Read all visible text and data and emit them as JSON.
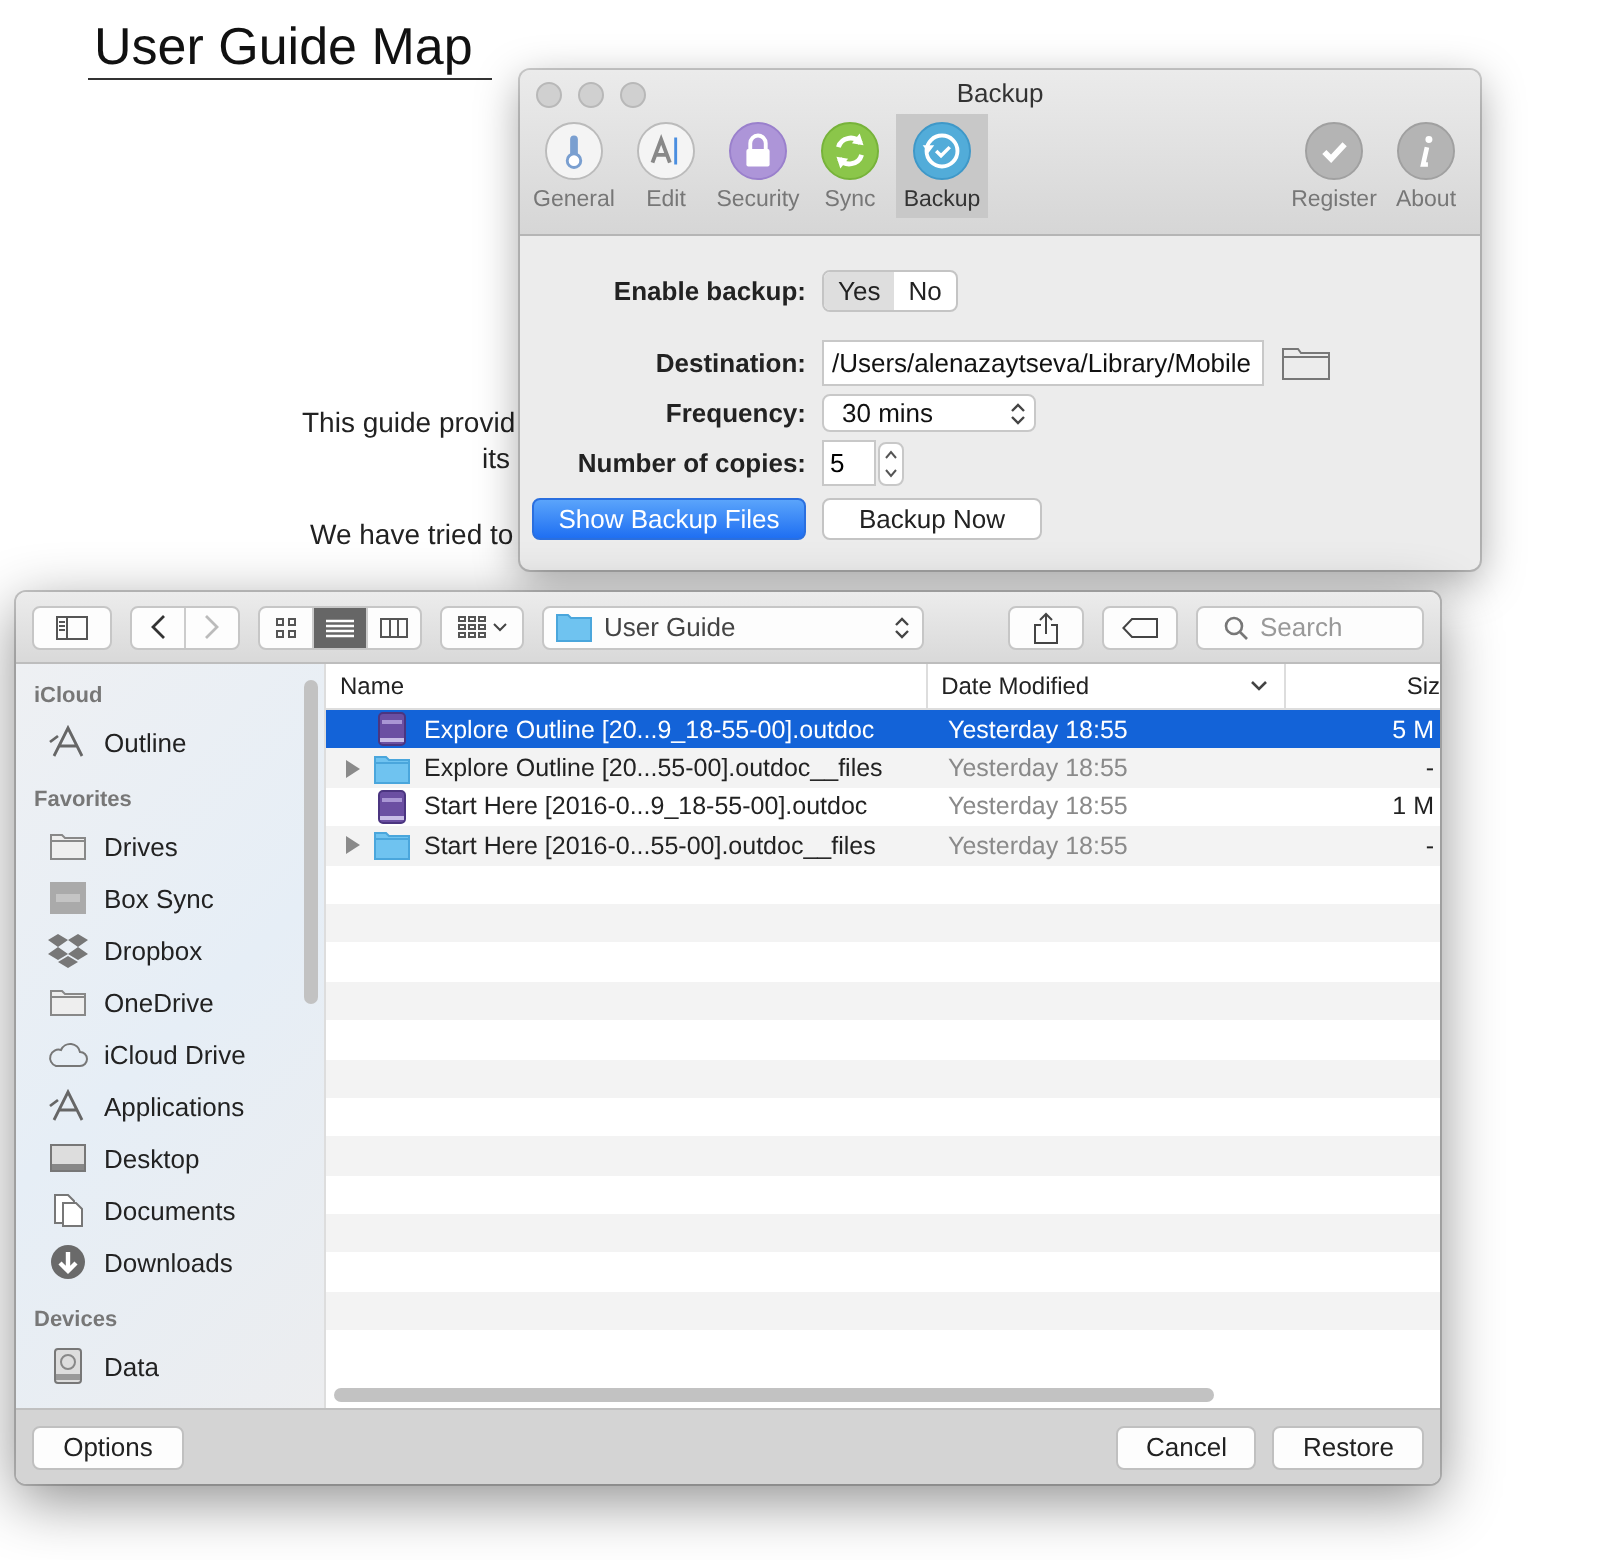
{
  "document": {
    "title": "User Guide Map",
    "paragraphs": [
      "This guide provid",
      "its",
      "We have tried to"
    ]
  },
  "preferences_window": {
    "title": "Backup",
    "tabs": [
      {
        "label": "General",
        "kind": "general",
        "selected": false
      },
      {
        "label": "Edit",
        "kind": "edit",
        "selected": false
      },
      {
        "label": "Security",
        "kind": "security",
        "selected": false
      },
      {
        "label": "Sync",
        "kind": "sync",
        "selected": false
      },
      {
        "label": "Backup",
        "kind": "backup",
        "selected": true
      }
    ],
    "extra_tabs": [
      {
        "label": "Register",
        "kind": "register"
      },
      {
        "label": "About",
        "kind": "about"
      }
    ],
    "enable_backup": {
      "label": "Enable backup:",
      "options": [
        {
          "label": "Yes",
          "selected": true
        },
        {
          "label": "No",
          "selected": false
        }
      ]
    },
    "destination": {
      "label": "Destination:",
      "value": "/Users/alenazaytseva/Library/Mobile"
    },
    "frequency": {
      "label": "Frequency:",
      "value": "30 mins"
    },
    "copies": {
      "label": "Number of copies:",
      "value": "5"
    },
    "buttons": [
      {
        "label": "Show Backup Files",
        "kind": "primary"
      },
      {
        "label": "Backup Now",
        "kind": "default"
      }
    ]
  },
  "file_dialog": {
    "view_modes": [
      {
        "kind": "icons",
        "selected": false
      },
      {
        "kind": "list",
        "selected": true
      },
      {
        "kind": "columns",
        "selected": false
      }
    ],
    "location": "User Guide",
    "search": {
      "placeholder": "Search"
    },
    "sidebar": [
      {
        "heading": "iCloud",
        "items": [
          {
            "label": "Outline",
            "kind": "app"
          }
        ]
      },
      {
        "heading": "Favorites",
        "items": [
          {
            "label": "Drives",
            "kind": "folder"
          },
          {
            "label": "Box Sync",
            "kind": "box"
          },
          {
            "label": "Dropbox",
            "kind": "dropbox"
          },
          {
            "label": "OneDrive",
            "kind": "folder"
          },
          {
            "label": "iCloud Drive",
            "kind": "cloud"
          },
          {
            "label": "Applications",
            "kind": "app"
          },
          {
            "label": "Desktop",
            "kind": "desktop"
          },
          {
            "label": "Documents",
            "kind": "documents"
          },
          {
            "label": "Downloads",
            "kind": "downloads"
          }
        ]
      },
      {
        "heading": "Devices",
        "items": [
          {
            "label": "Data",
            "kind": "disk"
          }
        ]
      }
    ],
    "columns": [
      "Name",
      "Date Modified",
      "Siz"
    ],
    "rows": [
      {
        "name": "Explore Outline [20...9_18-55-00].outdoc",
        "date": "Yesterday 18:55",
        "size": "5 M",
        "kind": "document",
        "selected": true
      },
      {
        "name": "Explore Outline [20...55-00].outdoc__files",
        "date": "Yesterday 18:55",
        "size": "-",
        "kind": "folder",
        "selected": false
      },
      {
        "name": "Start Here [2016-0...9_18-55-00].outdoc",
        "date": "Yesterday 18:55",
        "size": "1 M",
        "kind": "document",
        "selected": false
      },
      {
        "name": "Start Here [2016-0...55-00].outdoc__files",
        "date": "Yesterday 18:55",
        "size": "-",
        "kind": "folder",
        "selected": false
      }
    ],
    "buttons": [
      "Options",
      "Cancel",
      "Restore"
    ]
  }
}
